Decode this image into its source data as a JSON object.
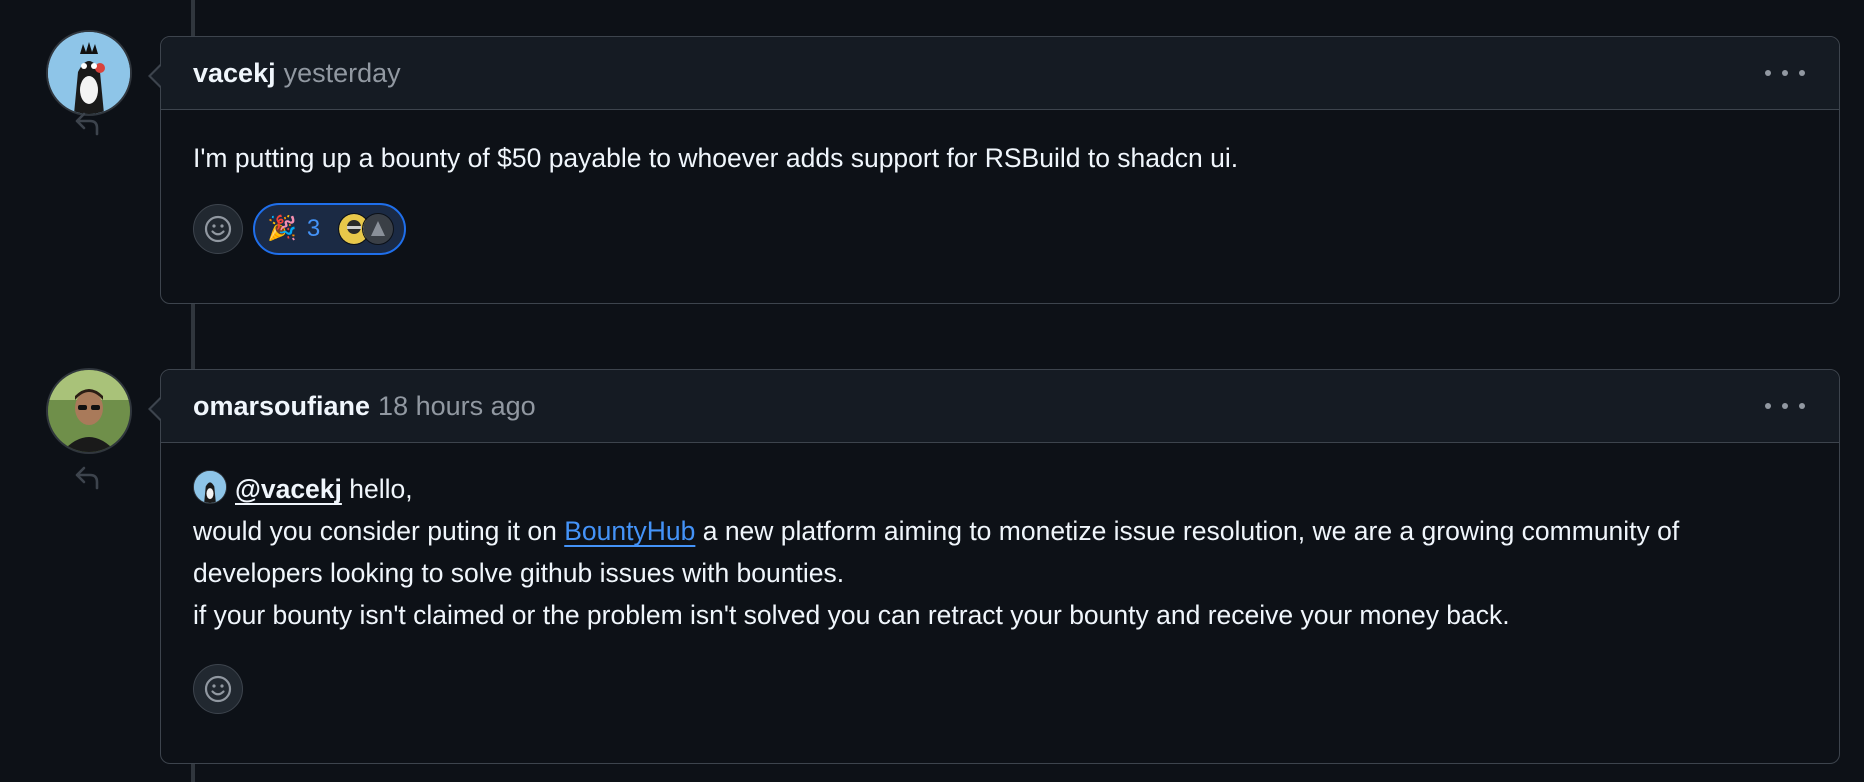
{
  "comments": [
    {
      "author": "vacekj",
      "time": "yesterday",
      "body": "I'm putting up a bounty of $50 payable to whoever adds support for RSBuild to shadcn ui.",
      "reactions": [
        {
          "emoji": "🎉",
          "count": "3"
        }
      ]
    },
    {
      "author": "omarsoufiane",
      "time": "18 hours ago",
      "mention": "@vacekj",
      "greeting": " hello,",
      "line2_before": "would you consider puting it on ",
      "link_text": "BountyHub",
      "line2_after": " a new platform aiming to monetize issue resolution, we are a growing community of developers looking to solve github issues with bounties.",
      "line3": "if your bounty isn't claimed or the problem isn't solved you can retract your bounty and receive your money back."
    }
  ],
  "icons": {
    "more": "kebab-horizontal-icon",
    "reply": "reply-icon",
    "emoji": "smiley-icon"
  },
  "colors": {
    "background": "#0d1117",
    "header": "#151b23",
    "border": "#3d444d",
    "link": "#4493f8",
    "reaction_border": "#1f6feb"
  }
}
